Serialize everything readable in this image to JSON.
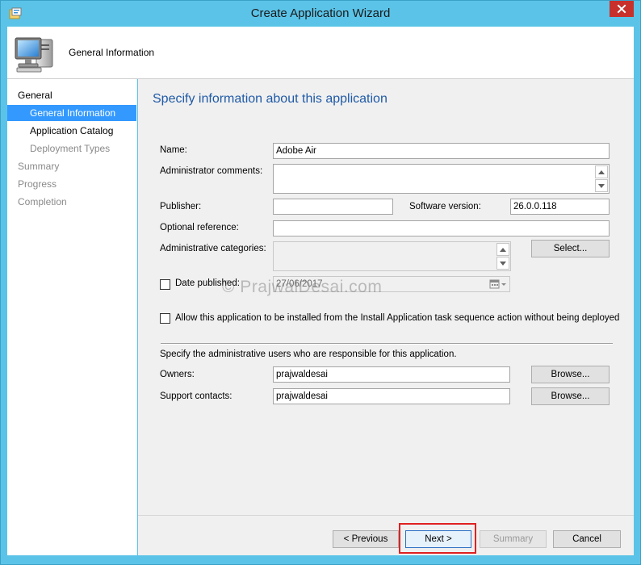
{
  "window": {
    "title": "Create Application Wizard",
    "icon": "app-wizard-icon",
    "close_icon": "close-icon",
    "close_color": "#c7302b"
  },
  "header": {
    "title": "General Information",
    "icon": "computer-icon"
  },
  "nav": {
    "items": [
      {
        "label": "General",
        "level": 1,
        "state": "normal"
      },
      {
        "label": "General Information",
        "level": 2,
        "state": "selected"
      },
      {
        "label": "Application Catalog",
        "level": 2,
        "state": "normal"
      },
      {
        "label": "Deployment Types",
        "level": 2,
        "state": "muted"
      },
      {
        "label": "Summary",
        "level": 1,
        "state": "muted"
      },
      {
        "label": "Progress",
        "level": 1,
        "state": "muted"
      },
      {
        "label": "Completion",
        "level": 1,
        "state": "muted"
      }
    ],
    "selected_color": "#3399ff"
  },
  "main": {
    "title": "Specify information about this application",
    "title_color": "#1f5aa6",
    "fields": {
      "name": {
        "label": "Name:",
        "value": "Adobe Air"
      },
      "admin_comments": {
        "label": "Administrator comments:",
        "value": ""
      },
      "publisher": {
        "label": "Publisher:",
        "value": ""
      },
      "software_version": {
        "label": "Software version:",
        "value": "26.0.0.118"
      },
      "optional_reference": {
        "label": "Optional reference:",
        "value": ""
      },
      "admin_categories": {
        "label": "Administrative categories:",
        "value": ""
      },
      "date_published": {
        "label": "Date published:",
        "value": "27/06/2017",
        "checked": false
      }
    },
    "select_button": "Select...",
    "allow_install": {
      "label": "Allow this application to be installed from the Install Application task sequence action without being deployed",
      "checked": false
    },
    "responsible_text": "Specify the administrative users who are responsible for this application.",
    "owners": {
      "label": "Owners:",
      "value": "prajwaldesai",
      "button": "Browse..."
    },
    "support_contacts": {
      "label": "Support contacts:",
      "value": "prajwaldesai",
      "button": "Browse..."
    },
    "watermark": "© PrajwalDesai.com"
  },
  "footer": {
    "previous": "< Previous",
    "next": "Next >",
    "summary": "Summary",
    "cancel": "Cancel",
    "highlight_color": "#e02020"
  }
}
